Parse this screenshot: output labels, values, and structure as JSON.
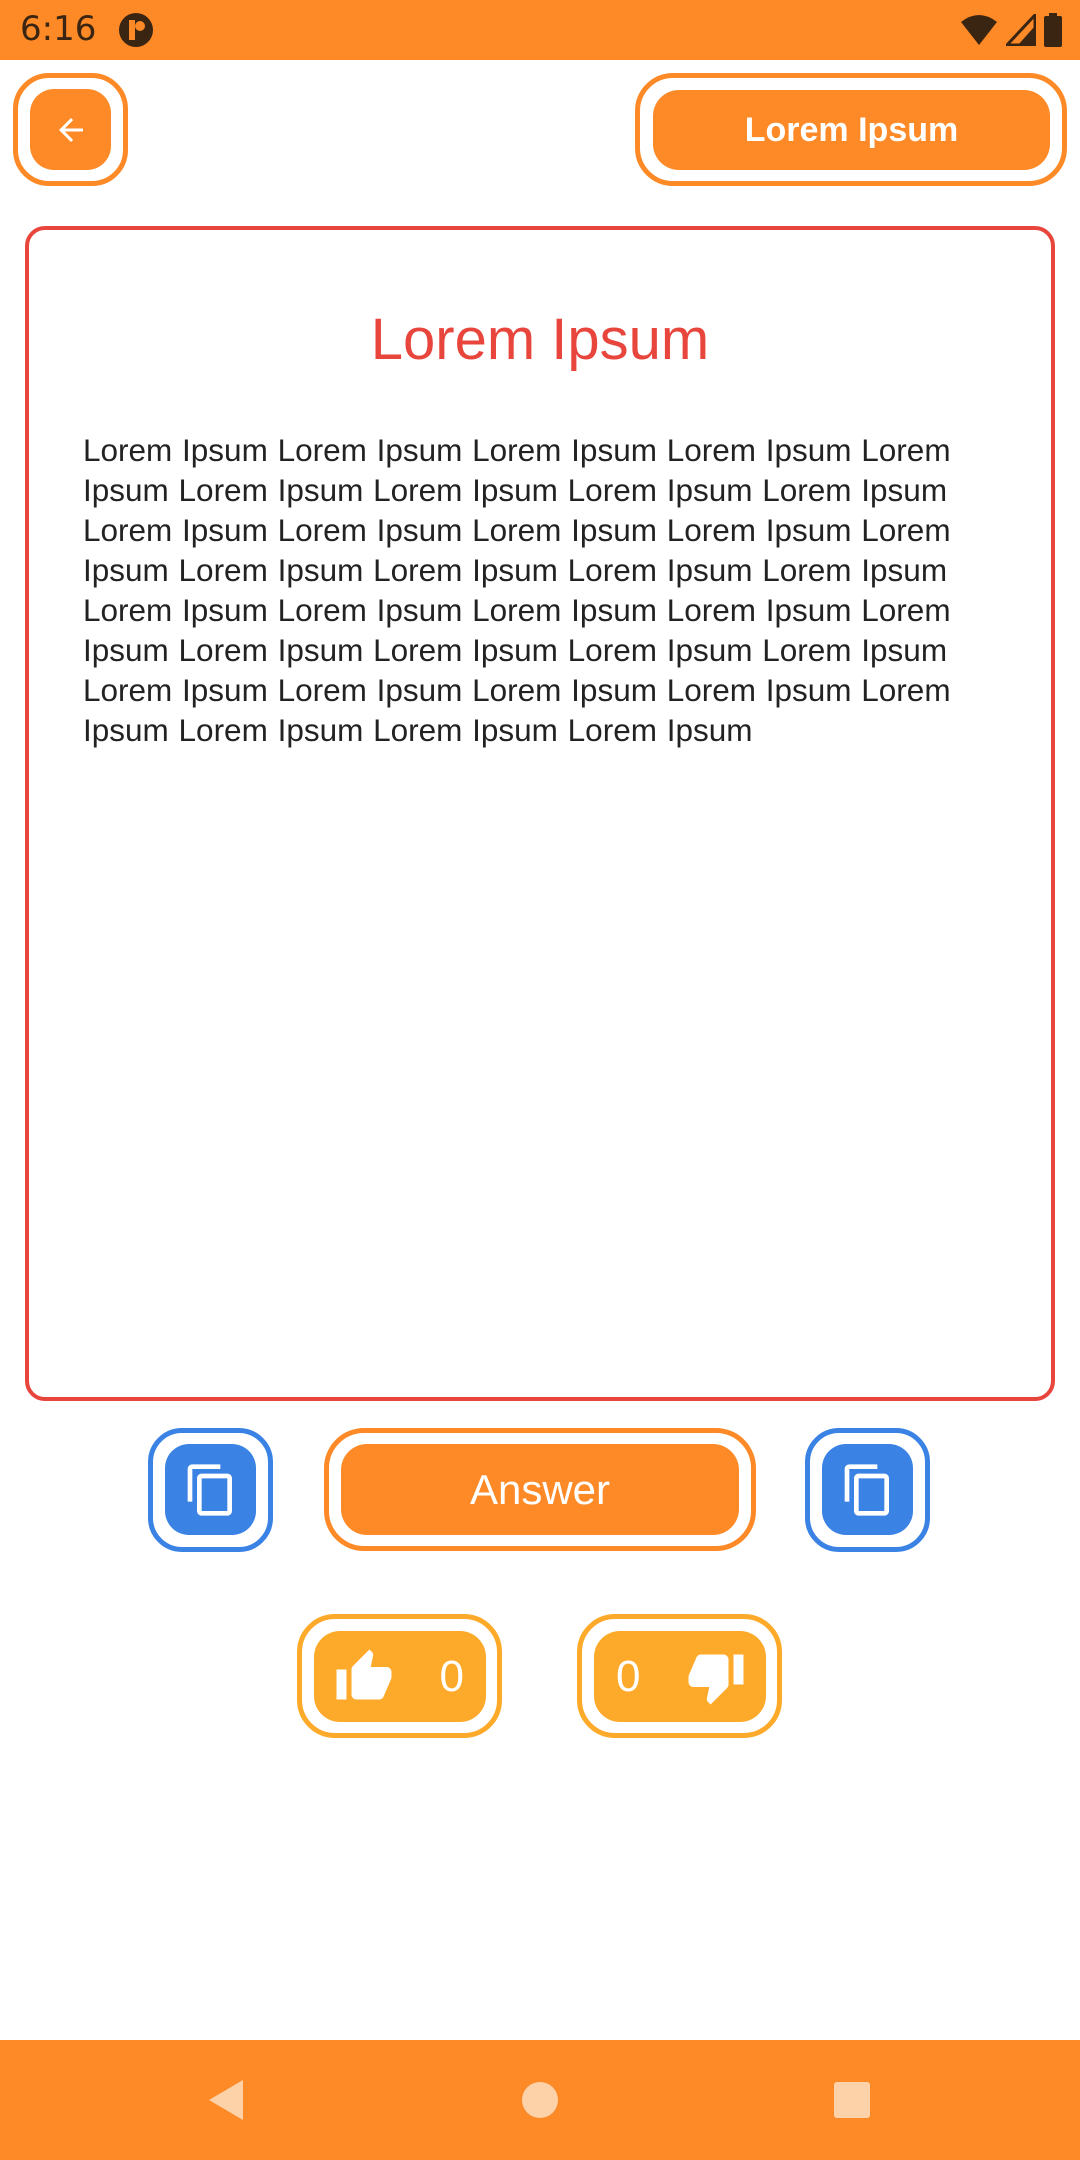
{
  "status_bar": {
    "time": "6:16",
    "icons": [
      "app-notification-icon",
      "wifi-icon",
      "signal-icon",
      "battery-icon"
    ]
  },
  "header": {
    "back_icon": "arrow-left-icon",
    "action_label": "Lorem Ipsum"
  },
  "card": {
    "title": "Lorem Ipsum",
    "body": "Lorem Ipsum Lorem Ipsum Lorem Ipsum Lorem Ipsum Lorem Ipsum Lorem Ipsum Lorem Ipsum Lorem Ipsum Lorem Ipsum Lorem Ipsum Lorem Ipsum Lorem Ipsum Lorem Ipsum Lorem Ipsum Lorem Ipsum Lorem Ipsum Lorem Ipsum Lorem Ipsum Lorem Ipsum Lorem Ipsum Lorem Ipsum Lorem Ipsum Lorem Ipsum Lorem Ipsum Lorem Ipsum Lorem Ipsum Lorem Ipsum Lorem Ipsum Lorem Ipsum Lorem Ipsum Lorem Ipsum Lorem Ipsum Lorem Ipsum Lorem Ipsum Lorem Ipsum"
  },
  "actions": {
    "left_copy_icon": "copy-icon",
    "answer_label": "Answer",
    "right_copy_icon": "copy-icon"
  },
  "votes": {
    "like_icon": "thumbs-up-icon",
    "like_count": "0",
    "dislike_count": "0",
    "dislike_icon": "thumbs-down-icon"
  },
  "nav": {
    "items": [
      "back-triangle-icon",
      "home-circle-icon",
      "recents-square-icon"
    ]
  },
  "colors": {
    "primary_orange": "#FD8A27",
    "vote_orange": "#FDAA2B",
    "card_red": "#E8453C",
    "copy_blue": "#3A82E4"
  }
}
